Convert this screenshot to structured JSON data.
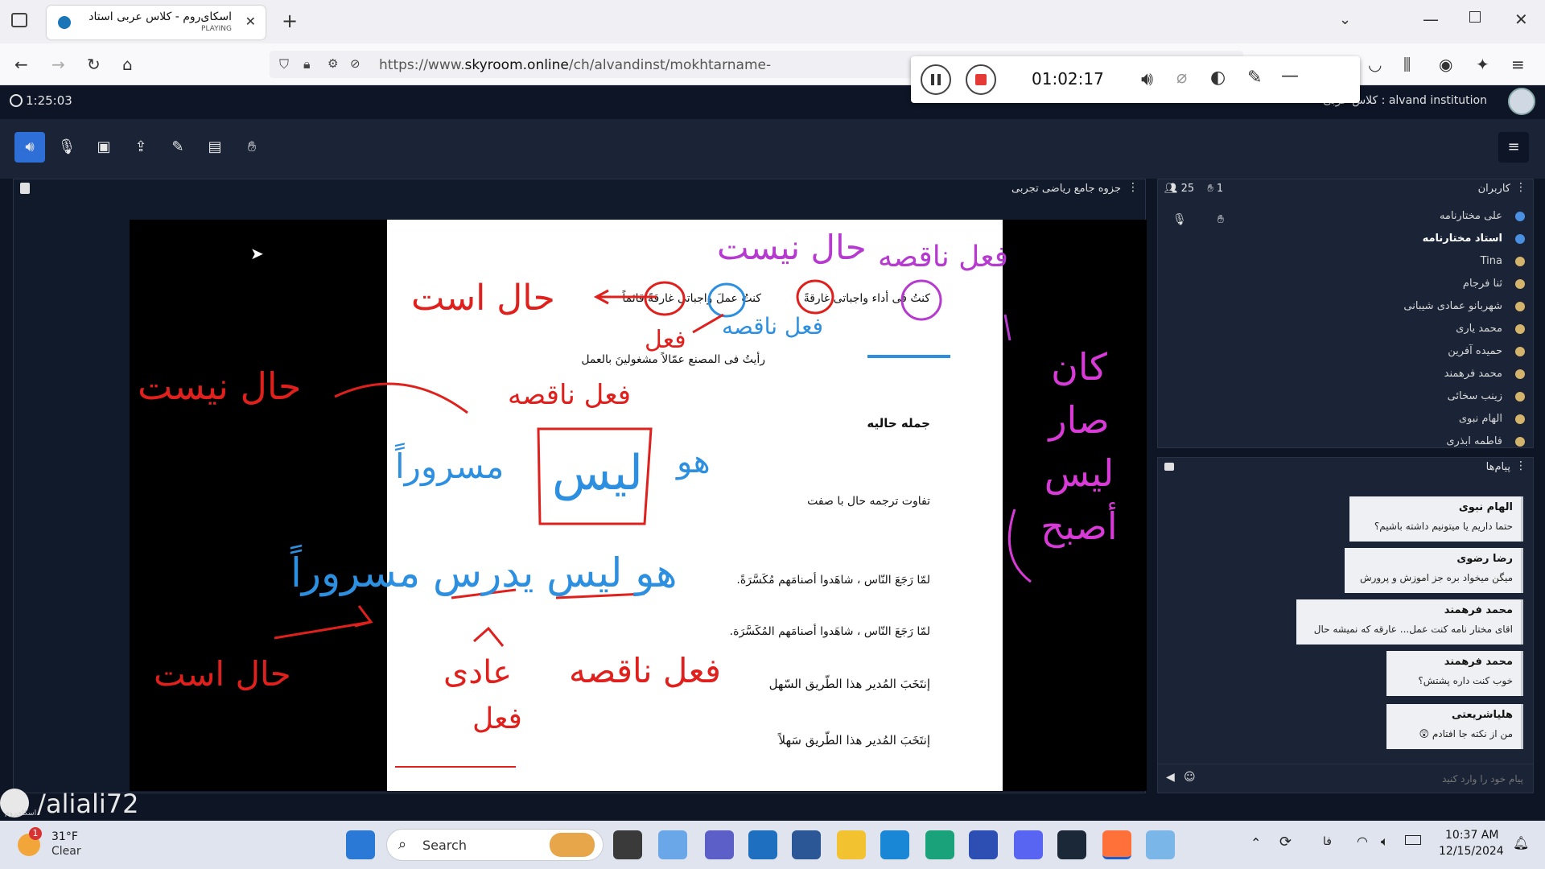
{
  "browser": {
    "tab_title": "اسکای‌روم - کلاس عربی استاد",
    "tab_status": "PLAYING",
    "new_tab": "+",
    "url_prefix": "https://www.",
    "url_host": "skyroom.online",
    "url_path": "/ch/alvandinst/mokhtarname-"
  },
  "recorder": {
    "time": "01:02:17"
  },
  "app": {
    "clock": "1:25:03",
    "room_title": "alvand institution : کلاس عربی"
  },
  "whiteboard": {
    "title": "جزوه جامع ریاضی تجربی",
    "page_lines": [
      "كنتُ فی أداء واجباتی غارقةً",
      "كنتُ عملَ واجباتی غارقةً قائماً",
      "رأیتُ فی المصنع عمّالاً مشغولینَ بالعمل",
      "جمله حالیه",
      "تفاوت ترجمه حال با صفت",
      "لمّا رَجَعَ النّاس ، شاهَدوا أصنامَهم مُکَسَّرَةً.",
      "لمّا رَجَعَ النّاس ، شاهَدوا أصنامَهم المُکَسَّرَة.",
      "إنتَخَبَ المُدیر هذا الطّریق السّهل",
      "إنتَخَبَ المُدیر هذا الطّریق سَهلاً"
    ],
    "annotations": {
      "hal_nist_top": "حال نیست",
      "fel_naqes_top": "فعل ناقصه",
      "hal_ast_top": "حال است",
      "fel_naqes_blue": "فعل ناقصه",
      "fel_red": "فعل",
      "kan_words": [
        "کان",
        "صار",
        "لیس",
        "أصبح"
      ],
      "hal_nist_left": "حال نیست",
      "fel_naqes_mid": "فعل ناقصه",
      "lays": "لیس",
      "howa": "هو",
      "masruran": "مسروراً",
      "sentence_blue": "هو لیس یدرس مسروراً",
      "hal_ast_bottom": "حال است",
      "fel_adi": "عادی",
      "fel_bottom": "فعل",
      "fel_naqes_bottom": "فعل ناقصه"
    },
    "watermark": "/aliali72",
    "watermark_logo_text": "اسکای‌روم"
  },
  "users": {
    "title": "کاربران",
    "count": "25",
    "hands": "1",
    "list": [
      {
        "name": "علی مختارنامه",
        "color": "#4a90e2",
        "bold": false
      },
      {
        "name": "استاد مختارنامه",
        "color": "#4a90e2",
        "bold": true
      },
      {
        "name": "Tina",
        "color": "#d4b36a",
        "bold": false
      },
      {
        "name": "ثنا فرجام",
        "color": "#d4b36a",
        "bold": false
      },
      {
        "name": "شهربانو عمادی شیبانی",
        "color": "#d4b36a",
        "bold": false
      },
      {
        "name": "محمد یاری",
        "color": "#d4b36a",
        "bold": false
      },
      {
        "name": "حمیده آفرین",
        "color": "#d4b36a",
        "bold": false
      },
      {
        "name": "محمد فرهمند",
        "color": "#d4b36a",
        "bold": false
      },
      {
        "name": "زینب سخائی",
        "color": "#d4b36a",
        "bold": false
      },
      {
        "name": "الهام نبوی",
        "color": "#d4b36a",
        "bold": false
      },
      {
        "name": "فاطمه ابذری",
        "color": "#d4b36a",
        "bold": false
      }
    ]
  },
  "messages": {
    "title": "پیام‌ها",
    "items": [
      {
        "name": "الهام نبوی",
        "text": "حتما داریم یا میتونیم داشته باشیم؟"
      },
      {
        "name": "رضا رضوی",
        "text": "میگن میخواد بره جز اموزش و پرورش"
      },
      {
        "name": "محمد فرهمند",
        "text": "اقای مختار نامه کنت عمل... عارقه که نمیشه حال"
      },
      {
        "name": "محمد فرهمند",
        "text": "خوب کنت داره پشتش؟"
      },
      {
        "name": "هلیاشریعتی",
        "text": "من از نکته جا افتادم 😲"
      }
    ],
    "input_placeholder": "پیام خود را وارد کنید"
  },
  "taskbar": {
    "weather_temp": "31°F",
    "weather_desc": "Clear",
    "weather_badge": "1",
    "search_label": "Search",
    "lang": "فا",
    "time": "10:37 AM",
    "date": "12/15/2024"
  }
}
